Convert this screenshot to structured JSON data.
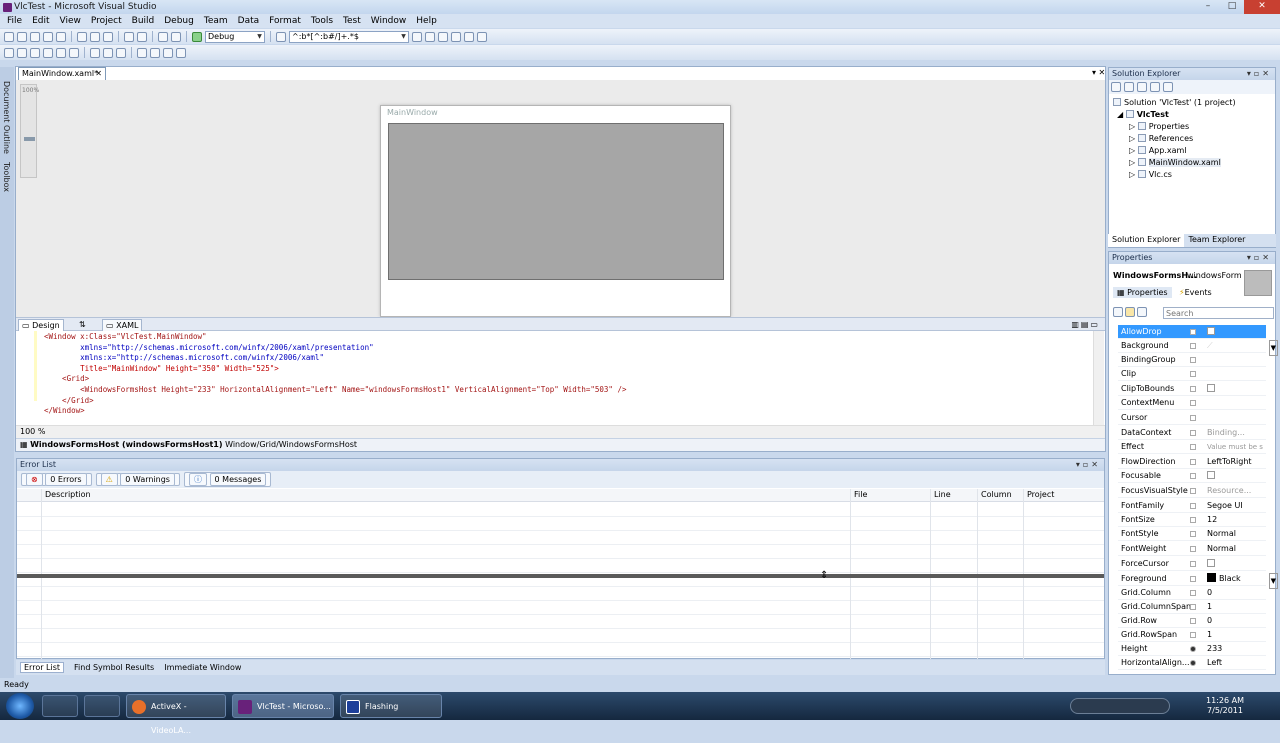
{
  "window": {
    "title": "VlcTest - Microsoft Visual Studio",
    "controls": [
      "–",
      "□",
      "✕"
    ]
  },
  "menu": [
    "File",
    "Edit",
    "View",
    "Project",
    "Build",
    "Debug",
    "Team",
    "Data",
    "Format",
    "Tools",
    "Test",
    "Window",
    "Help"
  ],
  "toolbar": {
    "config": "Debug",
    "find": "^:b*[^:b#/]+.*$"
  },
  "left_strip": {
    "doc_outline": "Document Outline",
    "toolbox": "Toolbox",
    "zoom": "100%"
  },
  "doc_tab": {
    "label": "MainWindow.xaml*",
    "close": "✕"
  },
  "designer": {
    "window_title": "MainWindow"
  },
  "split": {
    "design": "Design",
    "swap": "⇅",
    "xaml": "XAML"
  },
  "code": [
    "<Window x:Class=\"VlcTest.MainWindow\"",
    "        xmlns=\"http://schemas.microsoft.com/winfx/2006/xaml/presentation\"",
    "        xmlns:x=\"http://schemas.microsoft.com/winfx/2006/xaml\"",
    "        Title=\"MainWindow\" Height=\"350\" Width=\"525\">",
    "    <Grid>",
    "        <WindowsFormsHost Height=\"233\" HorizontalAlignment=\"Left\" Name=\"windowsFormsHost1\" VerticalAlignment=\"Top\" Width=\"503\" />",
    "    </Grid>",
    "</Window>"
  ],
  "editor": {
    "zoom": "100 %"
  },
  "breadcrumb": {
    "selected": "WindowsFormsHost (windowsFormsHost1)",
    "path": "Window/Grid/WindowsFormsHost"
  },
  "error_list": {
    "title": "Error List",
    "filters": {
      "errors": "0 Errors",
      "warnings": "0 Warnings",
      "messages": "0 Messages"
    },
    "columns": {
      "description": "Description",
      "file": "File",
      "line": "Line",
      "column": "Column",
      "project": "Project"
    }
  },
  "bottom_tabs": [
    "Error List",
    "Find Symbol Results",
    "Immediate Window"
  ],
  "solution_explorer": {
    "title": "Solution Explorer",
    "solution": "Solution 'VlcTest' (1 project)",
    "project": "VlcTest",
    "items": [
      "Properties",
      "References",
      "App.xaml",
      "MainWindow.xaml",
      "Vlc.cs"
    ],
    "tabs": [
      "Solution Explorer",
      "Team Explorer"
    ]
  },
  "properties": {
    "title": "Properties",
    "object_type": "WindowsFormsH...",
    "object_name": "windowsForm",
    "tabs": [
      "Properties",
      "Events"
    ],
    "search_placeholder": "Search",
    "rows": [
      {
        "name": "AllowDrop",
        "value": ""
      },
      {
        "name": "Background",
        "value": ""
      },
      {
        "name": "BindingGroup",
        "value": ""
      },
      {
        "name": "Clip",
        "value": ""
      },
      {
        "name": "ClipToBounds",
        "value": ""
      },
      {
        "name": "ContextMenu",
        "value": ""
      },
      {
        "name": "Cursor",
        "value": ""
      },
      {
        "name": "DataContext",
        "value": "Binding..."
      },
      {
        "name": "Effect",
        "value": "Value must be s"
      },
      {
        "name": "FlowDirection",
        "value": "LeftToRight"
      },
      {
        "name": "Focusable",
        "value": ""
      },
      {
        "name": "FocusVisualStyle",
        "value": "Resource..."
      },
      {
        "name": "FontFamily",
        "value": "Segoe UI"
      },
      {
        "name": "FontSize",
        "value": "12"
      },
      {
        "name": "FontStyle",
        "value": "Normal"
      },
      {
        "name": "FontWeight",
        "value": "Normal"
      },
      {
        "name": "ForceCursor",
        "value": ""
      },
      {
        "name": "Foreground",
        "value": "Black"
      },
      {
        "name": "Grid.Column",
        "value": "0"
      },
      {
        "name": "Grid.ColumnSpan",
        "value": "1"
      },
      {
        "name": "Grid.Row",
        "value": "0"
      },
      {
        "name": "Grid.RowSpan",
        "value": "1"
      },
      {
        "name": "Height",
        "value": "233"
      },
      {
        "name": "HorizontalAlign...",
        "value": "Left"
      }
    ]
  },
  "status": "Ready",
  "taskbar": {
    "tasks": [
      "ActiveX - VideoLA...",
      "VlcTest - Microso...",
      "Flashing"
    ],
    "time": "11:26 AM",
    "date": "7/5/2011"
  }
}
